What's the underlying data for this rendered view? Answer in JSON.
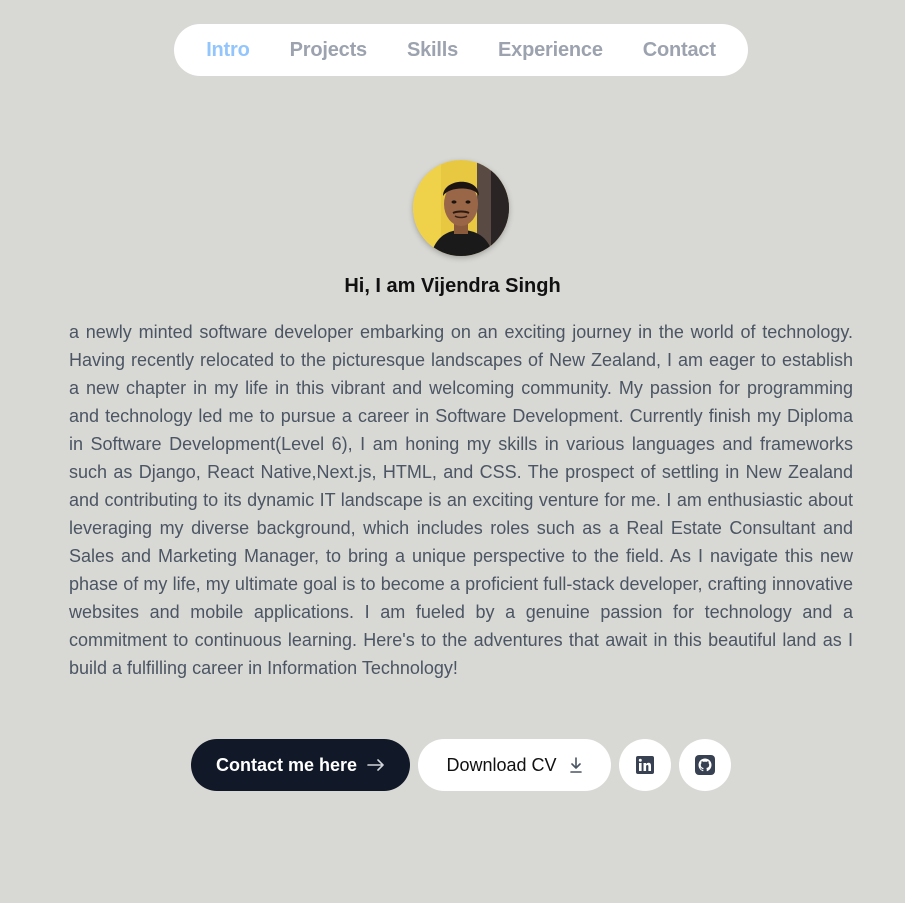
{
  "nav": {
    "items": [
      {
        "label": "Intro",
        "active": true
      },
      {
        "label": "Projects",
        "active": false
      },
      {
        "label": "Skills",
        "active": false
      },
      {
        "label": "Experience",
        "active": false
      },
      {
        "label": "Contact",
        "active": false
      }
    ]
  },
  "intro": {
    "greeting": "Hi, I am Vijendra Singh",
    "bio": "a newly minted software developer embarking on an exciting journey in the world of technology. Having recently relocated to the picturesque landscapes of New Zealand, I am eager to establish a new chapter in my life in this vibrant and welcoming community. My passion for programming and technology led me to pursue a career in Software Development. Currently finish my Diploma in Software Development(Level 6), I am honing my skills in various languages and frameworks such as Django, React Native,Next.js, HTML, and CSS. The prospect of settling in New Zealand and contributing to its dynamic IT landscape is an exciting venture for me. I am enthusiastic about leveraging my diverse background, which includes roles such as a Real Estate Consultant and Sales and Marketing Manager, to bring a unique perspective to the field. As I navigate this new phase of my life, my ultimate goal is to become a proficient full-stack developer, crafting innovative websites and mobile applications. I am fueled by a genuine passion for technology and a commitment to continuous learning. Here's to the adventures that await in this beautiful land as I build a fulfilling career in Information Technology!"
  },
  "actions": {
    "contact_label": "Contact me here",
    "contact_icon": "arrow-right-icon",
    "cv_label": "Download CV",
    "cv_icon": "download-icon",
    "linkedin_icon": "linkedin-icon",
    "github_icon": "github-icon"
  },
  "colors": {
    "background": "#d8d8d4",
    "nav_active": "#93c5fd",
    "nav_inactive": "#9ca3af",
    "primary_button": "#111827"
  }
}
